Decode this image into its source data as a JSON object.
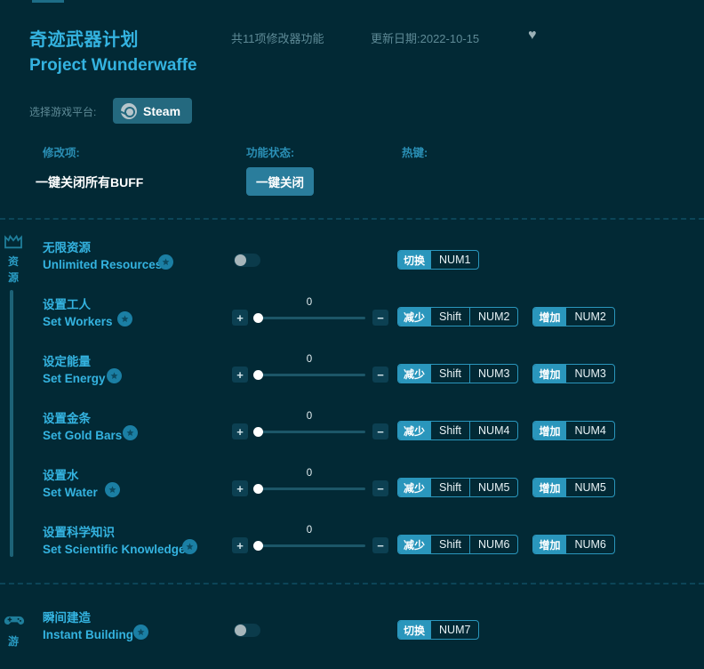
{
  "header": {
    "title_cn": "奇迹武器计划",
    "title_en": "Project Wunderwaffe",
    "feature_count": "共11项修改器功能",
    "update_date": "更新日期:2022-10-15",
    "favorite_icon": "♥"
  },
  "platform": {
    "label": "选择游戏平台:",
    "selected": "Steam"
  },
  "columns": {
    "option": "修改项:",
    "status": "功能状态:",
    "hotkey": "热键:"
  },
  "master": {
    "label": "一键关闭所有BUFF",
    "button": "一键关闭"
  },
  "categories": [
    {
      "icon": "crown-icon",
      "text": "资源"
    },
    {
      "icon": "gamepad-icon",
      "text": "游"
    }
  ],
  "rows": [
    {
      "name_cn": "无限资源",
      "name_en": "Unlimited Resources",
      "control": "toggle",
      "toggle_on": false,
      "hotkeys": [
        {
          "action": "切换",
          "keys": [
            "NUM1"
          ]
        }
      ]
    },
    {
      "name_cn": "设置工人",
      "name_en": "Set Workers",
      "control": "slider",
      "value": "0",
      "plus": "+",
      "minus": "−",
      "hotkeys": [
        {
          "action": "减少",
          "keys": [
            "Shift",
            "NUM2"
          ]
        },
        {
          "action": "增加",
          "keys": [
            "NUM2"
          ]
        }
      ]
    },
    {
      "name_cn": "设定能量",
      "name_en": "Set Energy",
      "control": "slider",
      "value": "0",
      "plus": "+",
      "minus": "−",
      "hotkeys": [
        {
          "action": "减少",
          "keys": [
            "Shift",
            "NUM3"
          ]
        },
        {
          "action": "增加",
          "keys": [
            "NUM3"
          ]
        }
      ]
    },
    {
      "name_cn": "设置金条",
      "name_en": "Set Gold Bars",
      "control": "slider",
      "value": "0",
      "plus": "+",
      "minus": "−",
      "hotkeys": [
        {
          "action": "减少",
          "keys": [
            "Shift",
            "NUM4"
          ]
        },
        {
          "action": "增加",
          "keys": [
            "NUM4"
          ]
        }
      ]
    },
    {
      "name_cn": "设置水",
      "name_en": "Set Water",
      "control": "slider",
      "value": "0",
      "plus": "+",
      "minus": "−",
      "hotkeys": [
        {
          "action": "减少",
          "keys": [
            "Shift",
            "NUM5"
          ]
        },
        {
          "action": "增加",
          "keys": [
            "NUM5"
          ]
        }
      ]
    },
    {
      "name_cn": "设置科学知识",
      "name_en": "Set Scientific Knowledge",
      "control": "slider",
      "value": "0",
      "plus": "+",
      "minus": "−",
      "hotkeys": [
        {
          "action": "减少",
          "keys": [
            "Shift",
            "NUM6"
          ]
        },
        {
          "action": "增加",
          "keys": [
            "NUM6"
          ]
        }
      ]
    },
    {
      "name_cn": "瞬间建造",
      "name_en": "Instant Building",
      "control": "toggle",
      "toggle_on": false,
      "hotkeys": [
        {
          "action": "切换",
          "keys": [
            "NUM7"
          ]
        }
      ]
    }
  ],
  "colors": {
    "background": "#022935",
    "accent": "#2a96bc",
    "title": "#34b3e0",
    "muted": "#5e8a96",
    "button": "#2a7d9c",
    "star_badge": "#1b7fa4"
  }
}
